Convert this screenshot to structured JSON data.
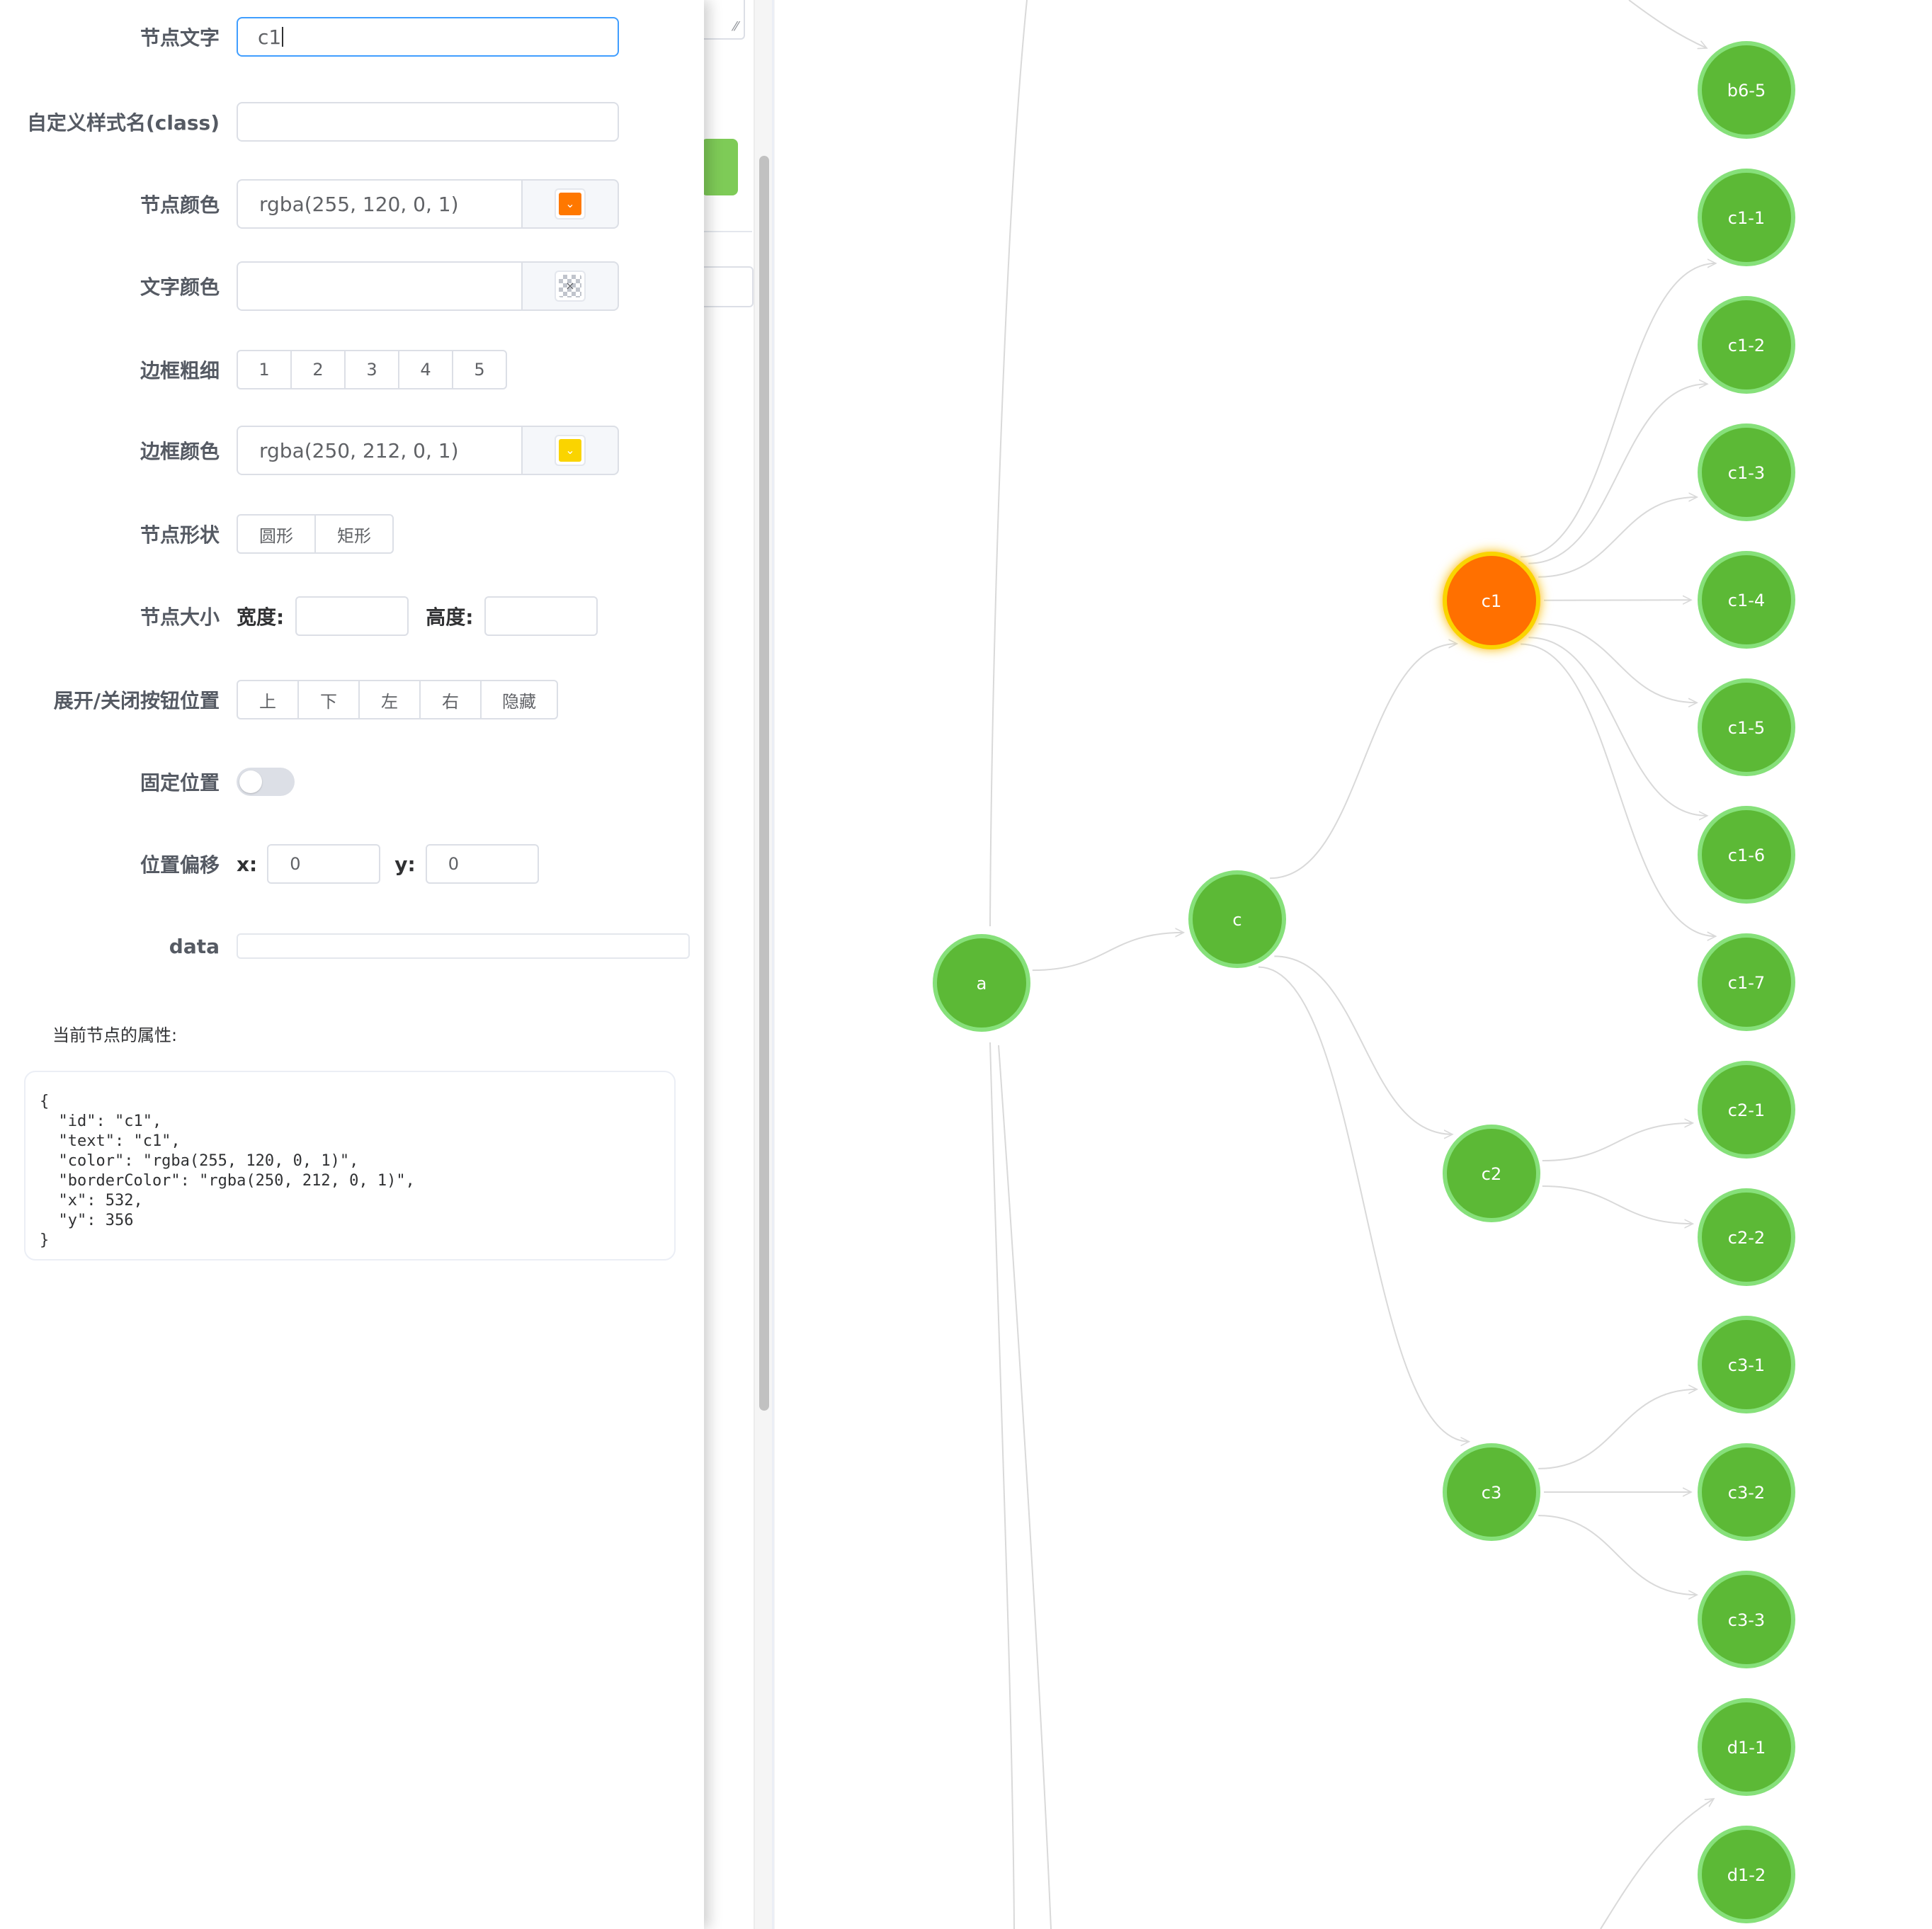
{
  "form": {
    "text_label": "节点文字",
    "text_value": "c1",
    "class_label": "自定义样式名(class)",
    "class_value": "",
    "color_label": "节点颜色",
    "color_value": "rgba(255, 120, 0, 1)",
    "color_swatch": "#ff7800",
    "font_color_label": "文字颜色",
    "font_color_value": "",
    "border_width_label": "边框粗细",
    "border_width_options": [
      "1",
      "2",
      "3",
      "4",
      "5"
    ],
    "border_color_label": "边框颜色",
    "border_color_value": "rgba(250, 212, 0, 1)",
    "border_color_swatch": "#fad400",
    "shape_label": "节点形状",
    "shape_options": [
      "圆形",
      "矩形"
    ],
    "size_label": "节点大小",
    "width_label": "宽度:",
    "height_label": "高度:",
    "expand_pos_label": "展开/关闭按钮位置",
    "expand_pos_options": [
      "上",
      "下",
      "左",
      "右",
      "隐藏"
    ],
    "fixed_label": "固定位置",
    "fixed_on": false,
    "offset_label": "位置偏移",
    "offset_x_label": "x:",
    "offset_x_value": "0",
    "offset_y_label": "y:",
    "offset_y_value": "0",
    "data_label": "data"
  },
  "props": {
    "title": "当前节点的属性:",
    "json_text": "{\n  \"id\": \"c1\",\n  \"text\": \"c1\",\n  \"color\": \"rgba(255, 120, 0, 1)\",\n  \"borderColor\": \"rgba(250, 212, 0, 1)\",\n  \"x\": 532,\n  \"y\": 356\n}"
  },
  "graph": {
    "node_color": "#5cb936",
    "node_border_color": "#86e07a",
    "selected_color": "#ff6f00",
    "selected_border_color": "#fad400",
    "line_color": "#d9d9d9",
    "nodes": [
      {
        "id": "a",
        "text": "a"
      },
      {
        "id": "c",
        "text": "c"
      },
      {
        "id": "c1",
        "text": "c1",
        "selected": true
      },
      {
        "id": "c2",
        "text": "c2"
      },
      {
        "id": "c3",
        "text": "c3"
      },
      {
        "id": "b6-5",
        "text": "b6-5"
      },
      {
        "id": "c1-1",
        "text": "c1-1"
      },
      {
        "id": "c1-2",
        "text": "c1-2"
      },
      {
        "id": "c1-3",
        "text": "c1-3"
      },
      {
        "id": "c1-4",
        "text": "c1-4"
      },
      {
        "id": "c1-5",
        "text": "c1-5"
      },
      {
        "id": "c1-6",
        "text": "c1-6"
      },
      {
        "id": "c1-7",
        "text": "c1-7"
      },
      {
        "id": "c2-1",
        "text": "c2-1"
      },
      {
        "id": "c2-2",
        "text": "c2-2"
      },
      {
        "id": "c3-1",
        "text": "c3-1"
      },
      {
        "id": "c3-2",
        "text": "c3-2"
      },
      {
        "id": "c3-3",
        "text": "c3-3"
      },
      {
        "id": "d1-1",
        "text": "d1-1"
      },
      {
        "id": "d1-2",
        "text": "d1-2"
      }
    ],
    "links": [
      [
        "a",
        "c"
      ],
      [
        "c",
        "c1"
      ],
      [
        "c",
        "c2"
      ],
      [
        "c",
        "c3"
      ],
      [
        "c1",
        "c1-1"
      ],
      [
        "c1",
        "c1-2"
      ],
      [
        "c1",
        "c1-3"
      ],
      [
        "c1",
        "c1-4"
      ],
      [
        "c1",
        "c1-5"
      ],
      [
        "c1",
        "c1-6"
      ],
      [
        "c1",
        "c1-7"
      ],
      [
        "c2",
        "c2-1"
      ],
      [
        "c2",
        "c2-2"
      ],
      [
        "c3",
        "c3-1"
      ],
      [
        "c3",
        "c3-2"
      ],
      [
        "c3",
        "c3-3"
      ]
    ]
  }
}
